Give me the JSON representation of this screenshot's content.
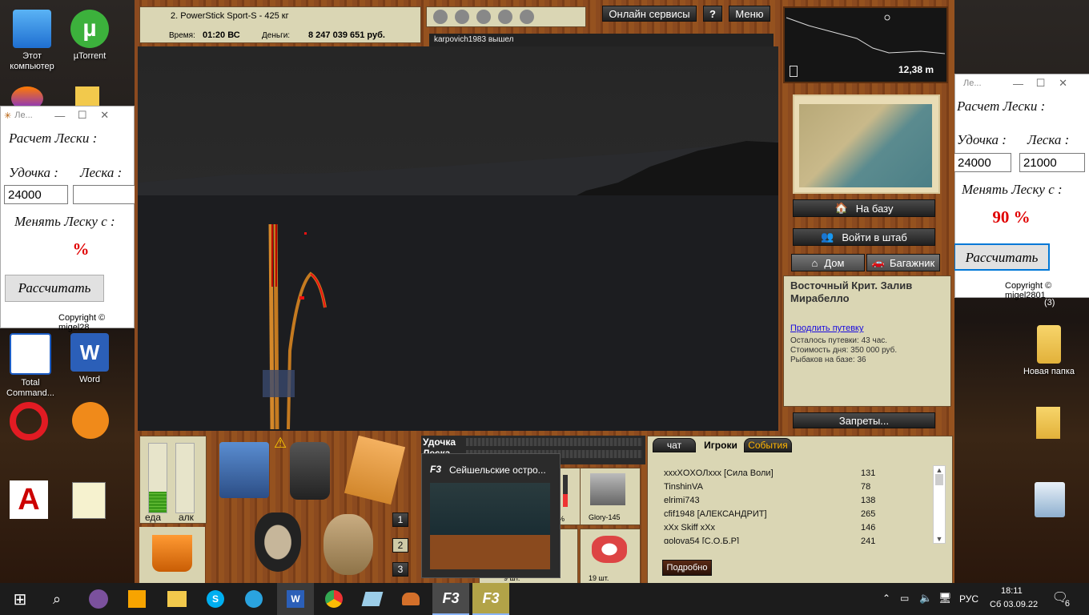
{
  "desktop": {
    "icons": [
      {
        "label": "Этот компьютер",
        "icon": "computer-icon"
      },
      {
        "label": "µTorrent",
        "icon": "utorrent-icon"
      },
      {
        "label": "Total Command...",
        "icon": "total-commander-icon"
      },
      {
        "label": "Word",
        "icon": "word-icon"
      },
      {
        "label": "Новая папка",
        "icon": "folder-icon"
      }
    ]
  },
  "helper_left": {
    "title": "Ле...",
    "heading": "Расчет Лески :",
    "rod_label": "Удочка :",
    "line_label": "Леска :",
    "rod_value": "24000",
    "line_value": "",
    "change_label": "Менять Леску с :",
    "percent": "%",
    "calc_button": "Рассчитать",
    "copyright": "Copyright © migel28"
  },
  "helper_right": {
    "title": "Ле...",
    "heading": "Расчет Лески :",
    "rod_label": "Удочка :",
    "line_label": "Леска :",
    "rod_value": "24000",
    "line_value": "21000",
    "change_label": "Менять Леску с :",
    "percent": "90 %",
    "calc_button": "Рассчитать",
    "copyright": "Copyright © migel2801",
    "extra": "(3)"
  },
  "game": {
    "rod_name": "2. PowerStick Sport-S - 425 кг",
    "time_label": "Время:",
    "time_value": "01:20 ВС",
    "money_label": "Деньги:",
    "money_value": "8 247 039 651 руб.",
    "online_button": "Онлайн сервисы",
    "help_button": "?",
    "menu_button": "Меню",
    "chat_message": "karpovich1983 вышел",
    "depth": "12,38 m",
    "to_base_button": "На базу",
    "hq_button": "Войти в штаб",
    "home_button": "Дом",
    "trunk_button": "Багажник",
    "location_title": "Восточный Крит. Залив Мирабелло",
    "extend_link": "Продлить путевку",
    "info_lines": [
      "Осталось путевки: 43 час.",
      "Стоимость дня: 350 000 руб.",
      "Рыбаков на базе: 36"
    ],
    "bans_button": "Запреты...",
    "food_label": "еда",
    "alc_label": "алк",
    "food_level": 0.3,
    "slots": [
      "1",
      "2",
      "3"
    ],
    "rod_panel_label1": "Удочка",
    "rod_panel_label2": "Леска",
    "bait1_name": "Glory-145",
    "bait1_pct": "%",
    "count1": "9 шт.",
    "count2": "19 шт.",
    "tabs": [
      "чат",
      "Игроки",
      "События"
    ],
    "players": [
      {
        "name": "xxxXOXOЛxxx [Сила Воли]",
        "value": "131"
      },
      {
        "name": "TinshinVA",
        "value": "78"
      },
      {
        "name": "elrimi743",
        "value": "138"
      },
      {
        "name": "cfif1948 [АЛЕКСАНДРИТ]",
        "value": "265"
      },
      {
        "name": "xXx Skiff xXx",
        "value": "146"
      },
      {
        "name": "golova54 [С.О.Б.Р]",
        "value": "241"
      }
    ],
    "details_button": "Подробно",
    "preview_title": "Сейшельские остро..."
  },
  "taskbar": {
    "lang": "РУС",
    "time": "18:11",
    "date": "Сб 03.09.22",
    "notif": "6",
    "apps": [
      "start-icon",
      "search-icon",
      "viber-icon",
      "media-player-icon",
      "explorer-icon",
      "skype-icon",
      "telegram-icon",
      "word-icon",
      "chrome-icon",
      "notes-icon",
      "game-helper-icon",
      "rf3-icon",
      "rf3-icon-2"
    ]
  }
}
